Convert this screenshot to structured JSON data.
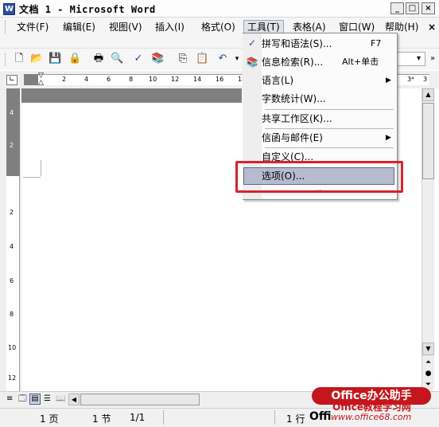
{
  "window": {
    "title": "文档 1 - Microsoft Word",
    "app_icon": "W",
    "min_label": "_",
    "max_label": "□",
    "close_label": "×"
  },
  "menubar": {
    "items": [
      "文件(F)",
      "编辑(E)",
      "视图(V)",
      "插入(I)",
      "格式(O)",
      "工具(T)",
      "表格(A)",
      "窗口(W)",
      "帮助(H)"
    ],
    "close_doc": "×"
  },
  "ruler": {
    "ticks": [
      "2",
      "4",
      "6",
      "8",
      "10",
      "12",
      "14",
      "16",
      "18",
      "3⁴",
      "3"
    ],
    "left_ticks": [
      "4",
      "2",
      "2",
      "4",
      "6",
      "8",
      "10",
      "12"
    ]
  },
  "tools_menu": {
    "items": [
      {
        "label": "拼写和语法(S)...",
        "shortcut": "F7"
      },
      {
        "label": "信息检索(R)...",
        "shortcut": "Alt+单击"
      },
      {
        "label": "语言(L)",
        "shortcut": "▶"
      },
      {
        "label": "字数统计(W)...",
        "shortcut": ""
      },
      {
        "label": "共享工作区(K)...",
        "shortcut": ""
      },
      {
        "label": "信函与邮件(E)",
        "shortcut": "▶"
      },
      {
        "label": "自定义(C)...",
        "shortcut": ""
      },
      {
        "label": "选项(O)...",
        "shortcut": ""
      }
    ],
    "expand": "⌄"
  },
  "status": {
    "page": "1 页",
    "section": "1 节",
    "fraction": "1/1",
    "line": "1 行",
    "col_label": "Offi"
  },
  "watermark": {
    "line1": "Office办公助手",
    "line2": "Office教程学习网",
    "url": "www.office68.com"
  },
  "colors": {
    "highlight_red": "#d8232a",
    "selected_item": "#b7bbcf"
  }
}
